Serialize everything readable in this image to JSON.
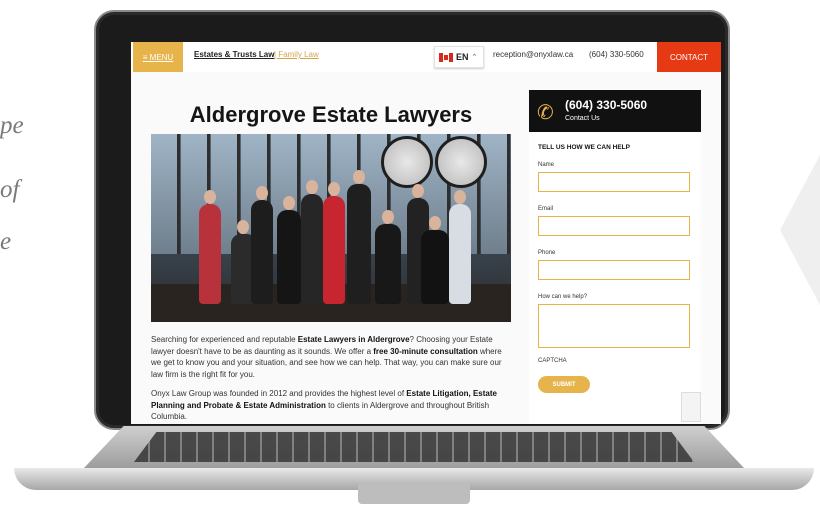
{
  "side_text": [
    "pe",
    "of",
    "e"
  ],
  "topbar": {
    "menu_label": "≡ MENU",
    "nav_estates": "Estates & Trusts Law",
    "nav_family": "| Family Law",
    "lang_label": "EN",
    "email": "reception@onyxlaw.ca",
    "phone": "(604) 330-5060",
    "contact_label": "CONTACT"
  },
  "main": {
    "title": "Aldergrove Estate Lawyers",
    "photo_alt": "Onyx Law Group team photo",
    "para1_a": "Searching for experienced and reputable ",
    "para1_b": "Estate Lawyers in Aldergrove",
    "para1_c": "? Choosing your Estate lawyer doesn't have to be as daunting as it sounds. We offer a ",
    "para1_d": "free 30-minute consultation",
    "para1_e": " where we get to know you and your situation, and see how we can help. That way, you can make sure our law firm is the right fit for you.",
    "para2_a": "Onyx Law Group was founded in 2012 and provides the highest level of ",
    "para2_b": "Estate Litigation, Estate Planning and Probate & Estate Administration",
    "para2_c": " to clients in Aldergrove and throughout British Columbia."
  },
  "sidebar": {
    "phone_number": "(604) 330-5060",
    "phone_sub": "Contact Us",
    "form_title": "TELL US HOW WE CAN HELP",
    "name_label": "Name",
    "email_label": "Email",
    "phone_label": "Phone",
    "help_label": "How can we help?",
    "captcha_label": "CAPTCHA",
    "submit_label": "SUBMIT"
  },
  "colors": {
    "accent": "#e7b34b",
    "contact_red": "#e63a14",
    "dark": "#111111"
  },
  "icons": {
    "menu": "hamburger-icon",
    "flag": "canada-flag-icon",
    "phone": "phone-icon",
    "recaptcha": "recaptcha-icon"
  }
}
